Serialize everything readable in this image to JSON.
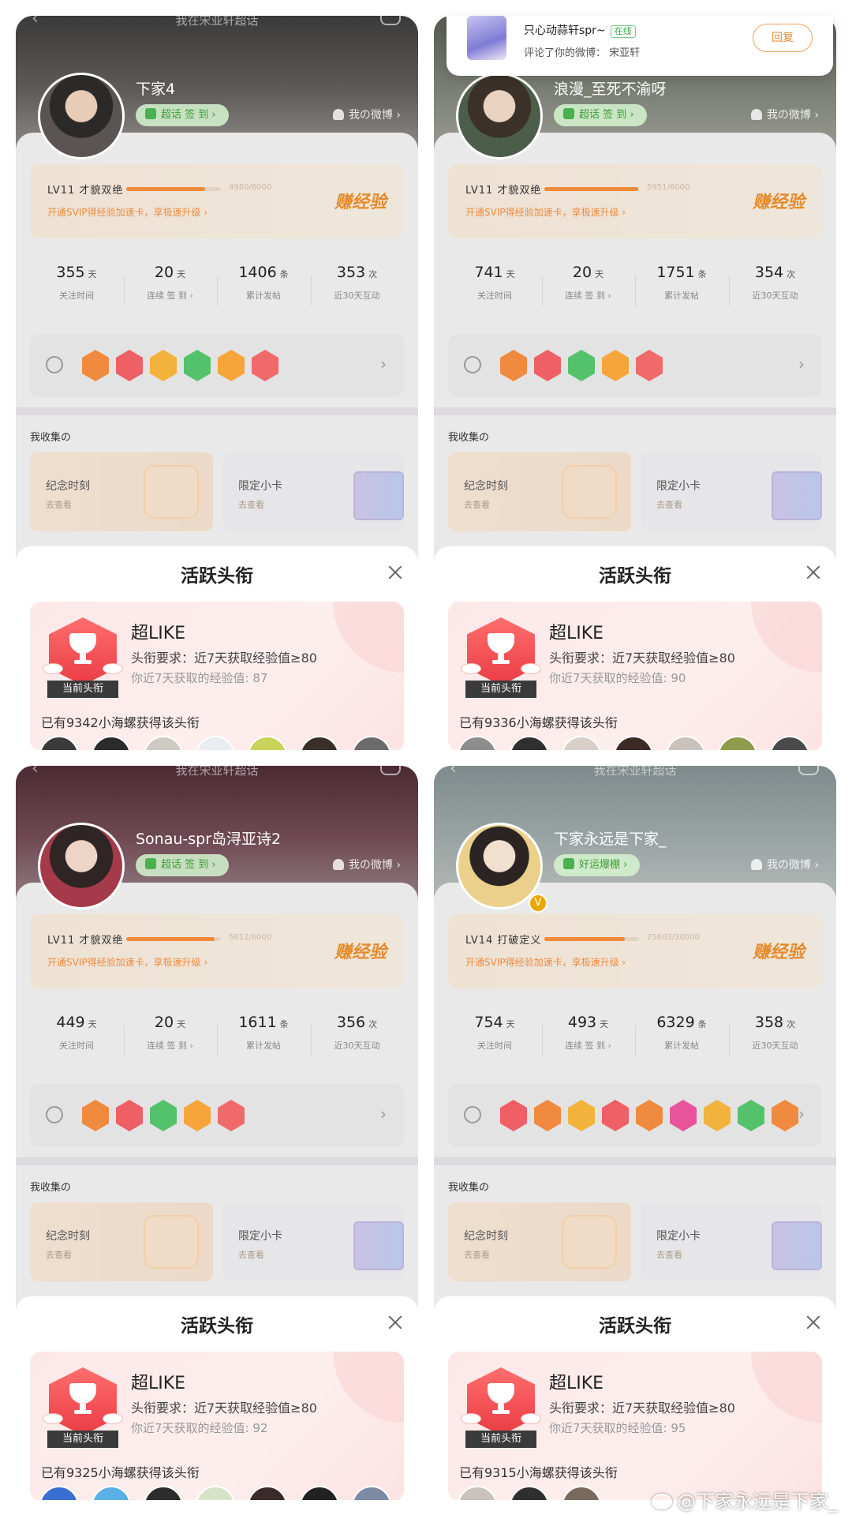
{
  "common": {
    "topic_title": "我在宋亚轩超话",
    "my_weibo": "我の微博 ›",
    "checkin": "超话 签 到 ›",
    "promo": "开通SVIP得经验加速卡，享极速升级 ›",
    "earn_exp": "赚经验",
    "stat_units": [
      "天",
      "天",
      "条",
      "次"
    ],
    "stat_labels": [
      "关注时间",
      "连续 签 到 ›",
      "累计发帖",
      "近30天互动"
    ],
    "collect_title": "我收集の",
    "memorial": "纪念时刻",
    "memorial_sub": "去查看",
    "limited": "限定小卡",
    "limited_sub": "去查看",
    "sheet_title": "活跃头衔",
    "title_name": "超LIKE",
    "title_req": "头衔要求：近7天获取经验值≥80",
    "current_tag": "当前头衔"
  },
  "panels": [
    {
      "username": "下家4",
      "checkin": "超话 签 到 ›",
      "level": "LV11 才貌双绝",
      "exp_text": "4980/6000",
      "exp_progress": 0.83,
      "stats": [
        "355",
        "20",
        "1406",
        "353"
      ],
      "medal_colors": [
        "#f08a3e",
        "#ef5f66",
        "#f2b23b",
        "#54c26a",
        "#f5a53a",
        "#f06a6a"
      ],
      "exp7": "你近7天获取的经验值: 87",
      "holders": "已有9342小海螺获得该头衔",
      "holder_colors": [
        "#3a3a3a",
        "#2b2b2b",
        "#cfc9c4",
        "#e9edf2",
        "#c9d25a",
        "#3a2e2a",
        "#6b6b6b"
      ]
    },
    {
      "username": "浪漫_至死不渝呀",
      "checkin": "超话 签 到 ›",
      "level": "LV11 才貌双绝",
      "exp_text": "5951/6000",
      "exp_progress": 0.99,
      "stats": [
        "741",
        "20",
        "1751",
        "354"
      ],
      "medal_colors": [
        "#f08a3e",
        "#ef5f66",
        "#54c26a",
        "#f5a53a",
        "#f06a6a"
      ],
      "exp7": "你近7天获取的经验值: 90",
      "holders": "已有9336小海螺获得该头衔",
      "holder_colors": [
        "#8d8d8d",
        "#2f2f2f",
        "#d8d0c8",
        "#3b2a26",
        "#c9c2bd",
        "#8f9a4a",
        "#4a4a4a"
      ]
    },
    {
      "username": "Sonau-spr岛浔亚诗2",
      "checkin": "超话 签 到 ›",
      "level": "LV11 才貌双绝",
      "exp_text": "5612/6000",
      "exp_progress": 0.93,
      "stats": [
        "449",
        "20",
        "1611",
        "356"
      ],
      "medal_colors": [
        "#f08a3e",
        "#ef5f66",
        "#54c26a",
        "#f5a53a",
        "#f06a6a"
      ],
      "exp7": "你近7天获取的经验值: 92",
      "holders": "已有9325小海螺获得该头衔",
      "holder_colors": [
        "#3b6ed1",
        "#5ab0e6",
        "#2c2c2c",
        "#d8e2c8",
        "#3a2a2a",
        "#222",
        "#7d8aa3"
      ]
    },
    {
      "username": "下家永远是下家_",
      "checkin": "好运爆棚 ›",
      "level": "LV14 打破定义",
      "exp_text": "25603/30000",
      "exp_progress": 0.85,
      "stats": [
        "754",
        "493",
        "6329",
        "358"
      ],
      "medal_colors": [
        "#ef5f66",
        "#f08a3e",
        "#f2b23b",
        "#ef5f66",
        "#f08a3e",
        "#e8559c",
        "#f2b23b",
        "#54c26a",
        "#f08a3e"
      ],
      "exp7": "你近7天获取的经验值: 95",
      "holders": "已有9315小海螺获得该头衔",
      "holder_colors": [
        "#c9c2bd",
        "#2f2f2f",
        "#7a6a5e"
      ]
    }
  ],
  "notification": {
    "name": "只心动蒜轩spr~",
    "status": "在线",
    "text": "评论了你的微博：  宋亚轩",
    "reply": "回复"
  },
  "watermark": "@下家永远是下家_"
}
